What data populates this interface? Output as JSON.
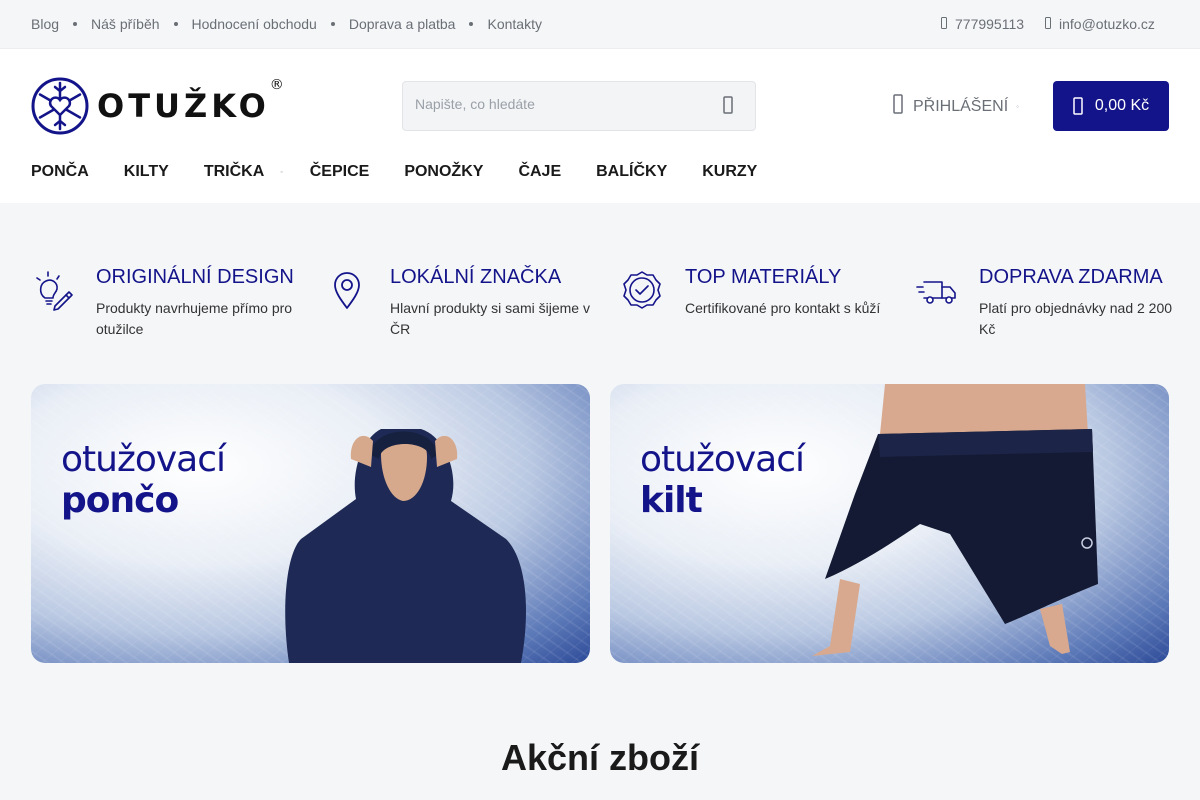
{
  "topbar": {
    "links": [
      "Blog",
      "Náš příběh",
      "Hodnocení obchodu",
      "Doprava a platba",
      "Kontakty"
    ],
    "phone": "777995113",
    "email": "info@otuzko.cz"
  },
  "header": {
    "logo_text": "OTUŽKO",
    "logo_reg": "®",
    "search_placeholder": "Napište, co hledáte",
    "login_label": "PŘIHLÁŠENÍ",
    "cart_total": "0,00 Kč"
  },
  "nav": {
    "items": [
      "PONČA",
      "KILTY",
      "TRIČKA",
      "ČEPICE",
      "PONOŽKY",
      "ČAJE",
      "BALÍČKY",
      "KURZY"
    ]
  },
  "benefits": [
    {
      "title": "ORIGINÁLNÍ DESIGN",
      "text": "Produkty navrhujeme přímo pro otužilce",
      "icon": "lightbulb-pencil-icon"
    },
    {
      "title": "LOKÁLNÍ ZNAČKA",
      "text": "Hlavní produkty si sami šijeme v ČR",
      "icon": "map-pin-icon"
    },
    {
      "title": "TOP MATERIÁLY",
      "text": "Certifikované pro kontakt s kůží",
      "icon": "badge-check-icon"
    },
    {
      "title": "DOPRAVA ZDARMA",
      "text": "Platí pro objednávky nad 2 200 Kč",
      "icon": "delivery-truck-icon"
    }
  ],
  "banners": [
    {
      "line1": "otužovací",
      "line2": "pončo"
    },
    {
      "line1": "otužovací",
      "line2": "kilt"
    }
  ],
  "section": {
    "title": "Akční zboží"
  },
  "colors": {
    "brand": "#14148a",
    "background": "#f5f6f8"
  }
}
